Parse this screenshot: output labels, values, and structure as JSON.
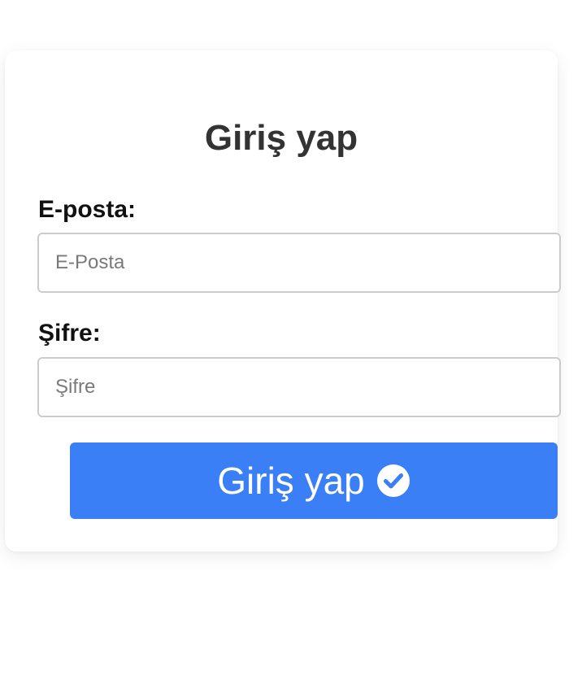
{
  "login": {
    "title": "Giriş yap",
    "email_label": "E-posta:",
    "email_placeholder": "E-Posta",
    "password_label": "Şifre:",
    "password_placeholder": "Şifre",
    "submit_label": "Giriş yap",
    "submit_icon": "check-circle-icon"
  },
  "colors": {
    "button_background": "#3a7ff6",
    "title_text": "#333333",
    "input_border": "#cccccc"
  }
}
